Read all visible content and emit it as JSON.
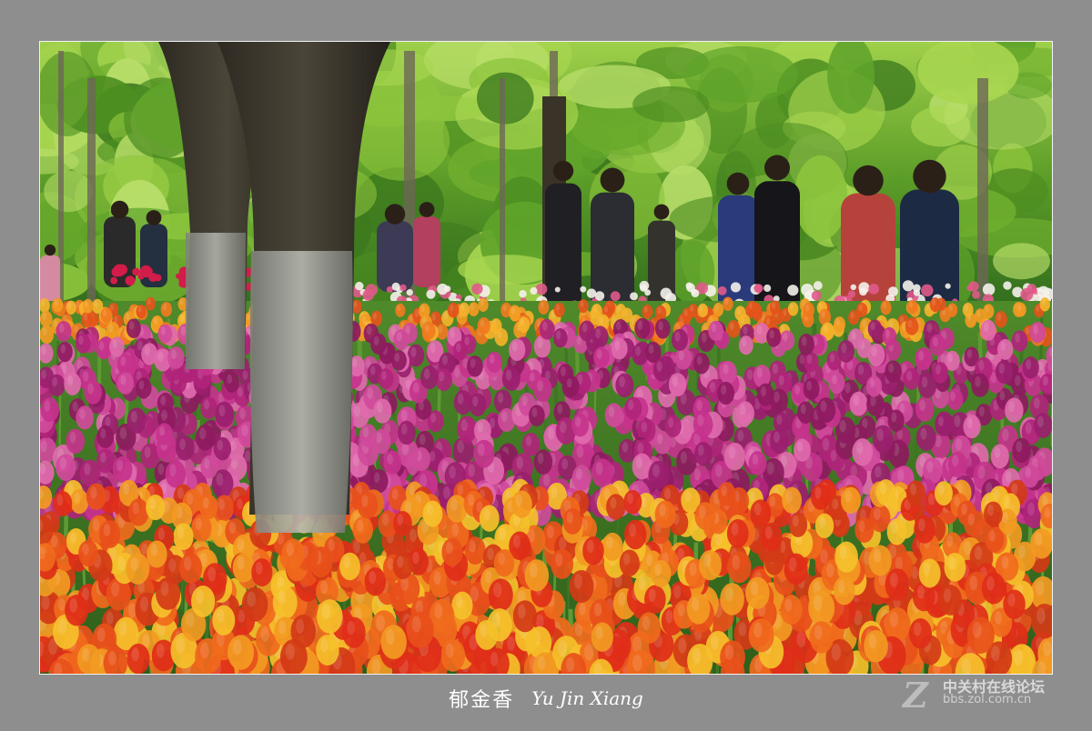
{
  "caption": {
    "chinese": "郁金香",
    "pinyin": "Yu Jin Xiang"
  },
  "watermark": {
    "logo": "Z",
    "site_name": "中关村在线论坛",
    "url": "bbs.zol.com.cn"
  },
  "colors": {
    "frame": "#8e8e8e",
    "foliage": "#6fae2e",
    "tulip_magenta": "#b0247a",
    "tulip_orange": "#e8501a",
    "tulip_yellow": "#f2a21a"
  }
}
